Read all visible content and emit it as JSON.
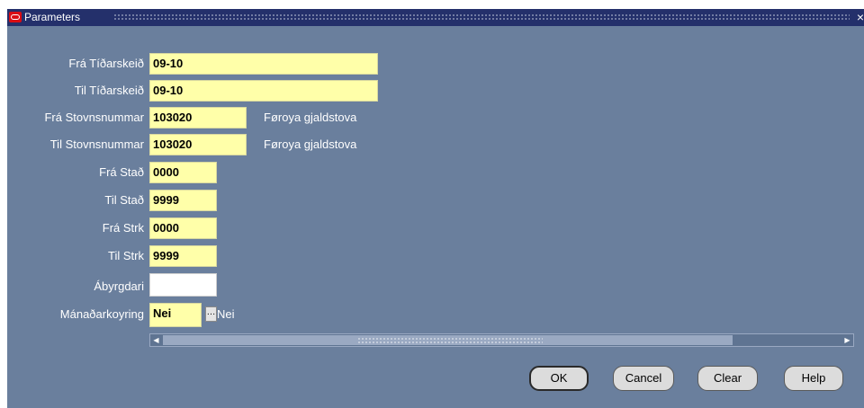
{
  "window": {
    "title": "Parameters",
    "close_glyph": "×"
  },
  "params": [
    {
      "label": "Frá Tíðarskeið",
      "value": "09-10",
      "description": ""
    },
    {
      "label": "Til Tíðarskeið",
      "value": "09-10",
      "description": ""
    },
    {
      "label": "Frá Stovnsnummar",
      "value": "103020",
      "description": "Føroya gjaldstova"
    },
    {
      "label": "Til Stovnsnummar",
      "value": "103020",
      "description": "Føroya gjaldstova"
    },
    {
      "label": "Frá Stað",
      "value": "0000",
      "description": ""
    },
    {
      "label": "Til Stað",
      "value": "9999",
      "description": ""
    },
    {
      "label": "Frá Strk",
      "value": "0000",
      "description": ""
    },
    {
      "label": "Til Strk",
      "value": "9999",
      "description": ""
    },
    {
      "label": "Ábyrgdari",
      "value": "",
      "description": ""
    },
    {
      "label": "Mánaðarkoyring",
      "value": "Nei",
      "description": "Nei"
    }
  ],
  "lov_button_glyph": "…",
  "buttons": {
    "ok": "OK",
    "cancel": "Cancel",
    "clear": "Clear",
    "help": "Help"
  },
  "colors": {
    "background": "#6a7f9d",
    "titlebar": "#24306b",
    "field_yellow": "#ffffa9",
    "logo_red": "#d90d14"
  },
  "icons": [
    "oracle-logo-icon",
    "close-icon",
    "ellipsis-icon",
    "left-arrow-icon",
    "right-arrow-icon"
  ]
}
